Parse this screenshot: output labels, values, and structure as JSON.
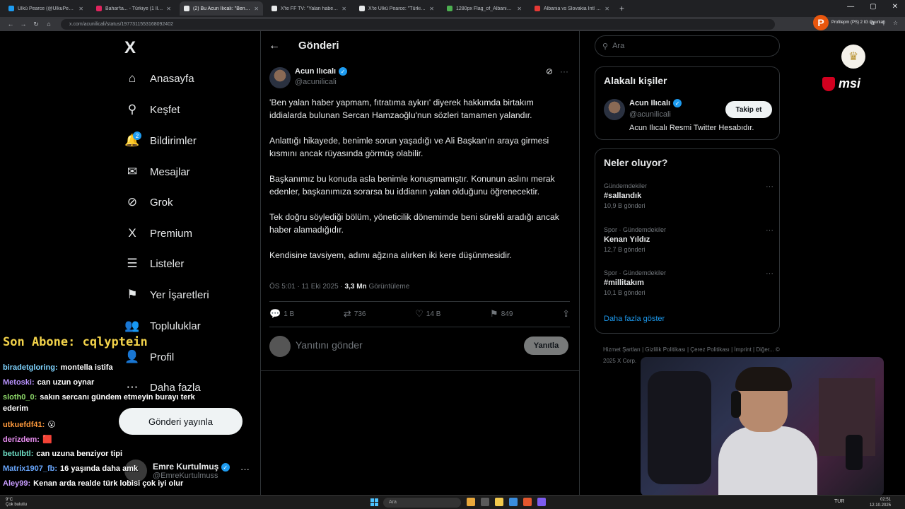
{
  "browser": {
    "tabs": [
      {
        "label": "Ülkü Pearce (@UlkuPearce) / X",
        "color": "#1d9bf0",
        "active": false
      },
      {
        "label": "Bahar'ta... - Türkiye (1 İl) M...",
        "color": "#e0245e",
        "active": false
      },
      {
        "label": "(2) Bu Acun Ilıcalı: \"Ben yalan...",
        "color": "#e7e9ea",
        "active": true
      },
      {
        "label": "X'te FF TV: \"Yalan haberi...",
        "color": "#e7e9ea",
        "active": false
      },
      {
        "label": "X'te Ülkü Pearce: \"Türkiye'nin D...",
        "color": "#e7e9ea",
        "active": false
      },
      {
        "label": "1280px Flag_of_Albania.svg.pn...",
        "color": "#4caf50",
        "active": false
      },
      {
        "label": "Albania vs Slovakia Intl UEL Bafa...",
        "color": "#e53935",
        "active": false
      }
    ],
    "new_tab": "+",
    "url": "x.com/acunilicali/status/1977311553168092402",
    "profile_initial": "P",
    "profile_text": "Profilepm (PS) 2 IG Oyunlar"
  },
  "nav": {
    "logo": "X",
    "items": [
      {
        "label": "Anasayfa",
        "icon": "home-icon",
        "glyph": "⌂"
      },
      {
        "label": "Keşfet",
        "icon": "search-icon",
        "glyph": "⚲"
      },
      {
        "label": "Bildirimler",
        "icon": "bell-icon",
        "glyph": "🔔",
        "badge": "2"
      },
      {
        "label": "Mesajlar",
        "icon": "mail-icon",
        "glyph": "✉"
      },
      {
        "label": "Grok",
        "icon": "grok-icon",
        "glyph": "⊘"
      },
      {
        "label": "Premium",
        "icon": "x-premium-icon",
        "glyph": "X"
      },
      {
        "label": "Listeler",
        "icon": "list-icon",
        "glyph": "☰"
      },
      {
        "label": "Yer İşaretleri",
        "icon": "bookmark-icon",
        "glyph": "⚑"
      },
      {
        "label": "Topluluklar",
        "icon": "communities-icon",
        "glyph": "👥"
      },
      {
        "label": "Profil",
        "icon": "profile-icon",
        "glyph": "👤"
      },
      {
        "label": "Daha fazla",
        "icon": "more-icon",
        "glyph": "⋯"
      }
    ],
    "post_button": "Gönderi yayınla",
    "account": {
      "name": "Emre Kurtulmuş",
      "handle": "@EmreKurtulmuss",
      "more": "···"
    }
  },
  "main": {
    "back": "←",
    "title": "Gönderi",
    "tweet": {
      "author": "Acun Ilıcalı",
      "handle": "@acunilicali",
      "paragraphs": [
        "'Ben yalan haber yapmam, fıtratıma aykırı' diyerek hakkımda birtakım iddialarda bulunan Sercan Hamzaoğlu'nun sözleri tamamen yalandır.",
        "Anlattığı hikayede, benimle sorun yaşadığı ve Ali Başkan'ın araya girmesi kısmını ancak rüyasında görmüş olabilir.",
        "Başkanımız bu konuda asla benimle konuşmamıştır. Konunun aslını merak edenler, başkanımıza sorarsa bu iddianın yalan olduğunu öğrenecektir.",
        "Tek doğru söylediği bölüm, yöneticilik dönemimde beni sürekli aradığı ancak haber alamadığıdır.",
        "Kendisine tavsiyem, adımı ağzına alırken iki kere düşünmesidir."
      ],
      "timestamp": "ÖS 5:01 · 11 Eki 2025 · ",
      "views_count": "3,3 Mn",
      "views_label": " Görüntüleme",
      "replies": "1 B",
      "retweets": "736",
      "likes": "14 B",
      "bookmarks": "849"
    },
    "reply_placeholder": "Yanıtını gönder",
    "reply_button": "Yanıtla"
  },
  "right": {
    "search_placeholder": "Ara",
    "related": {
      "title": "Alakalı kişiler",
      "name": "Acun Ilıcalı",
      "handle": "@acunilicali",
      "follow": "Takip et",
      "bio": "Acun Ilıcalı Resmi Twitter Hesabıdır."
    },
    "trends": {
      "title": "Neler oluyor?",
      "items": [
        {
          "category": "Gündemdekiler",
          "title": "#sallandık",
          "count": "10,9 B gönderi"
        },
        {
          "category": "Spor · Gündemdekiler",
          "title": "Kenan Yıldız",
          "count": "12,7 B gönderi"
        },
        {
          "category": "Spor · Gündemdekiler",
          "title": "#millitakım",
          "count": "10,1 B gönderi"
        }
      ],
      "show_more": "Daha fazla göster"
    },
    "footer": "Hizmet Şartları | Gizlilik Politikası | Çerez Politikası | İmprint | Diğer... © 2025 X Corp."
  },
  "overlay": {
    "last_sub": "Son Abone: cqlyptein",
    "sponsor": "msi",
    "chat": [
      {
        "user": "biradetgloring:",
        "msg": "montella istifa",
        "color": "#7fd4ff"
      },
      {
        "user": "Metoski:",
        "msg": "can uzun oynar",
        "color": "#b993ff"
      },
      {
        "user": "sloth0_0:",
        "msg": "sakın sercanı gündem etmeyin burayı terk",
        "color": "#8fdc6b"
      },
      {
        "user": "",
        "msg": "ederim",
        "color": "#ffffff"
      },
      {
        "user": "utkuefdf41:",
        "msg": "😮",
        "color": "#ff9a3c"
      },
      {
        "user": "derizdem:",
        "msg": "🟥",
        "color": "#e88df0"
      },
      {
        "user": "betulbtl:",
        "msg": "can uzuna benziyor tipi",
        "color": "#6fe0c8"
      },
      {
        "user": "Matrix1907_fb:",
        "msg": "16 yaşında daha amk",
        "color": "#6aa8ff"
      },
      {
        "user": "Aley99:",
        "msg": "Kenan arda realde türk lobisi çok iyi olur",
        "color": "#c89cff"
      }
    ]
  },
  "taskbar": {
    "weather_temp": "9°C",
    "weather_text": "Çok bulutlu",
    "search": "Ara",
    "time": "02:51",
    "date": "12.10.2025",
    "lang": "TUR"
  }
}
